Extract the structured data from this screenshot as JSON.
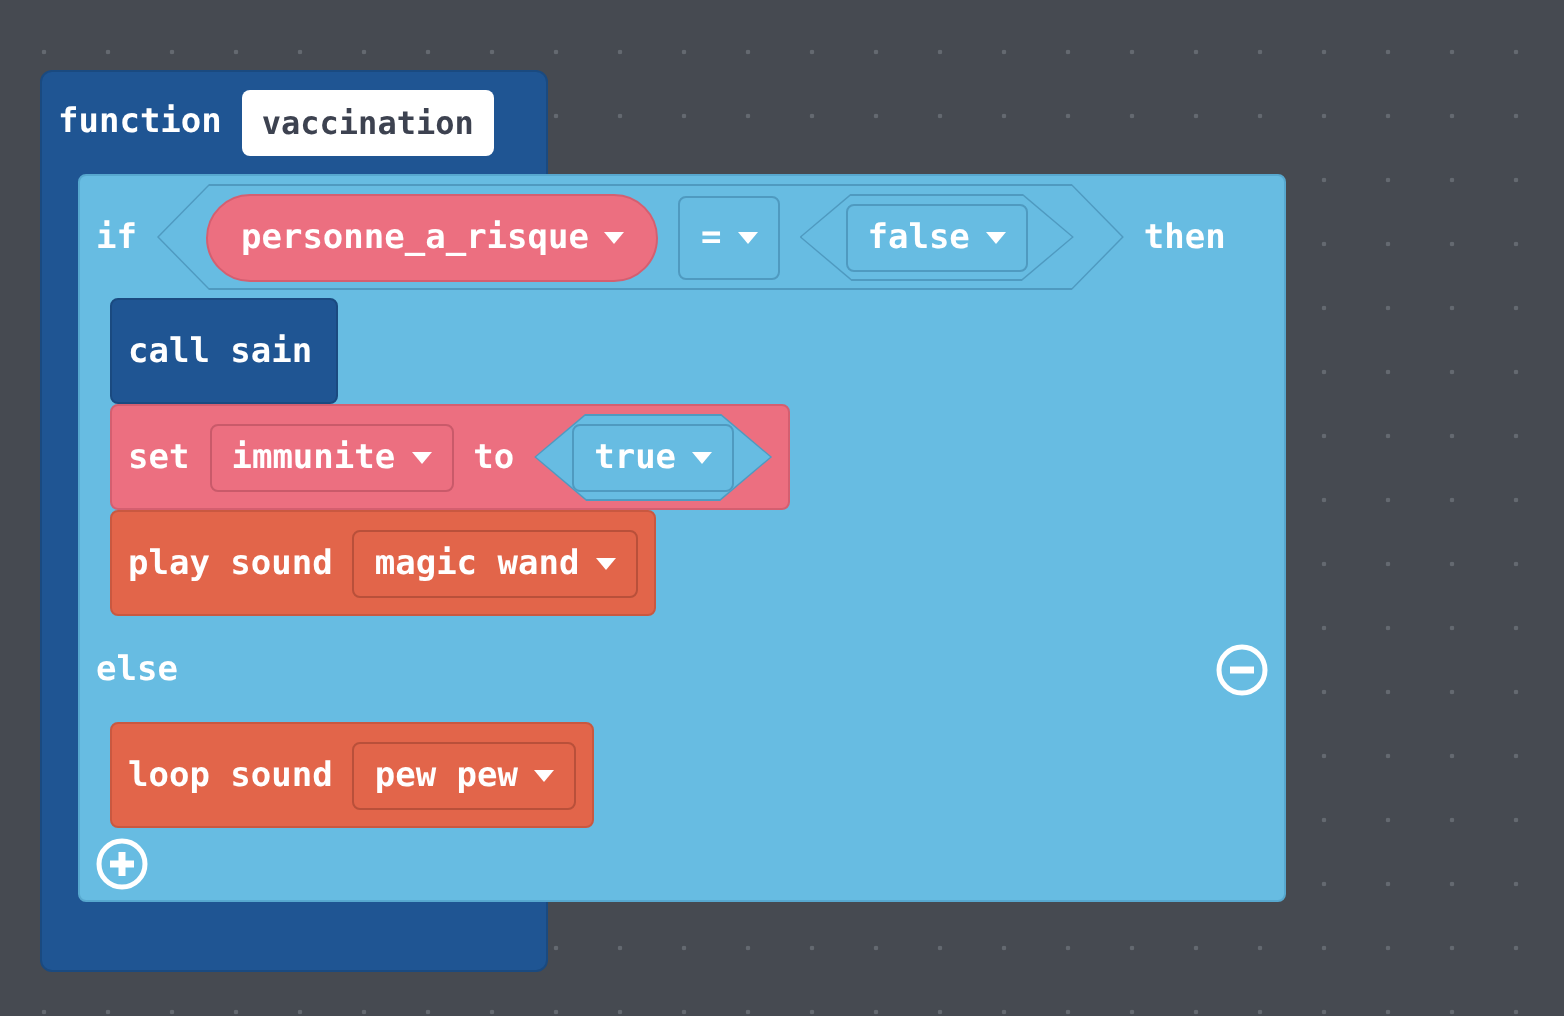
{
  "function": {
    "keyword": "function",
    "name": "vaccination",
    "body": {
      "keyword": "if",
      "condition": {
        "variable": "personne_a_risque",
        "operator": "=",
        "value": "false"
      },
      "then_keyword": "then",
      "then_blocks": [
        {
          "kind": "call",
          "label": "call sain"
        },
        {
          "kind": "set",
          "label": "set",
          "variable": "immunite",
          "to": "to",
          "value": "true"
        },
        {
          "kind": "sound",
          "label": "play sound",
          "sound": "magic wand"
        }
      ],
      "else_keyword": "else",
      "else_blocks": [
        {
          "kind": "sound",
          "label": "loop sound",
          "sound": "pew pew"
        }
      ]
    }
  }
}
